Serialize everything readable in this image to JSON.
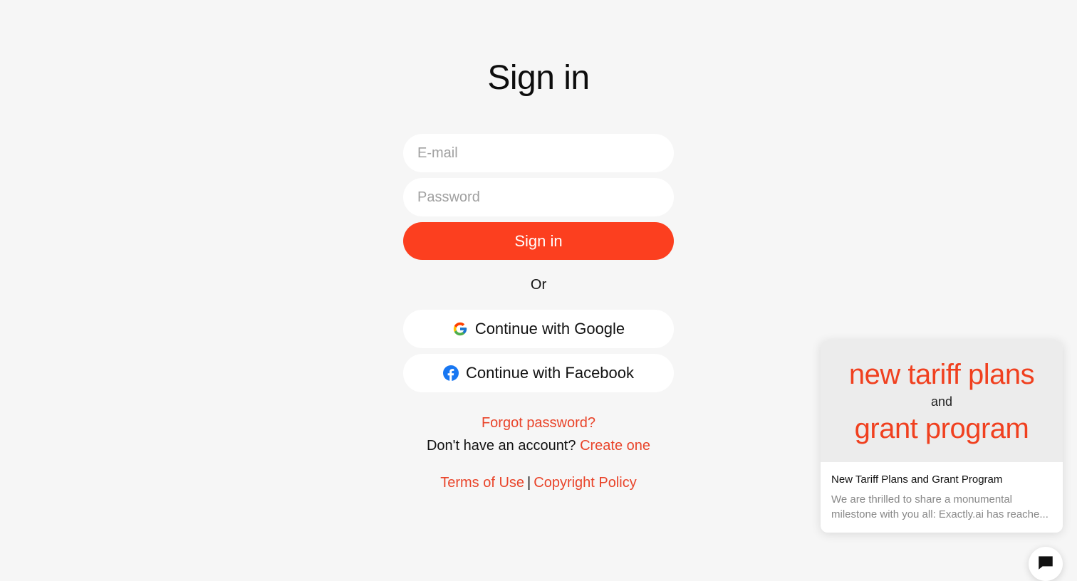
{
  "page": {
    "title": "Sign in"
  },
  "form": {
    "email_placeholder": "E-mail",
    "email_value": "",
    "password_placeholder": "Password",
    "password_value": "",
    "submit_label": "Sign in",
    "divider_text": "Or",
    "google_label": "Continue with Google",
    "facebook_label": "Continue with Facebook"
  },
  "links": {
    "forgot_password": "Forgot password?",
    "no_account_prompt": "Don't have an account?",
    "create_account": "Create one",
    "terms": "Terms of Use",
    "separator": "|",
    "copyright": "Copyright Policy"
  },
  "promo": {
    "banner_line1": "new tariff plans",
    "banner_line2": "and",
    "banner_line3": "grant program",
    "title": "New Tariff Plans and Grant Program",
    "text": "We are thrilled to share a monumental milestone with you all: Exactly.ai has reache..."
  },
  "icons": {
    "google": "google-g-icon",
    "facebook": "facebook-icon",
    "chat": "chat-bubble-icon"
  },
  "colors": {
    "accent": "#fc3f1f",
    "link": "#e9442a",
    "background": "#f6f6f6"
  }
}
